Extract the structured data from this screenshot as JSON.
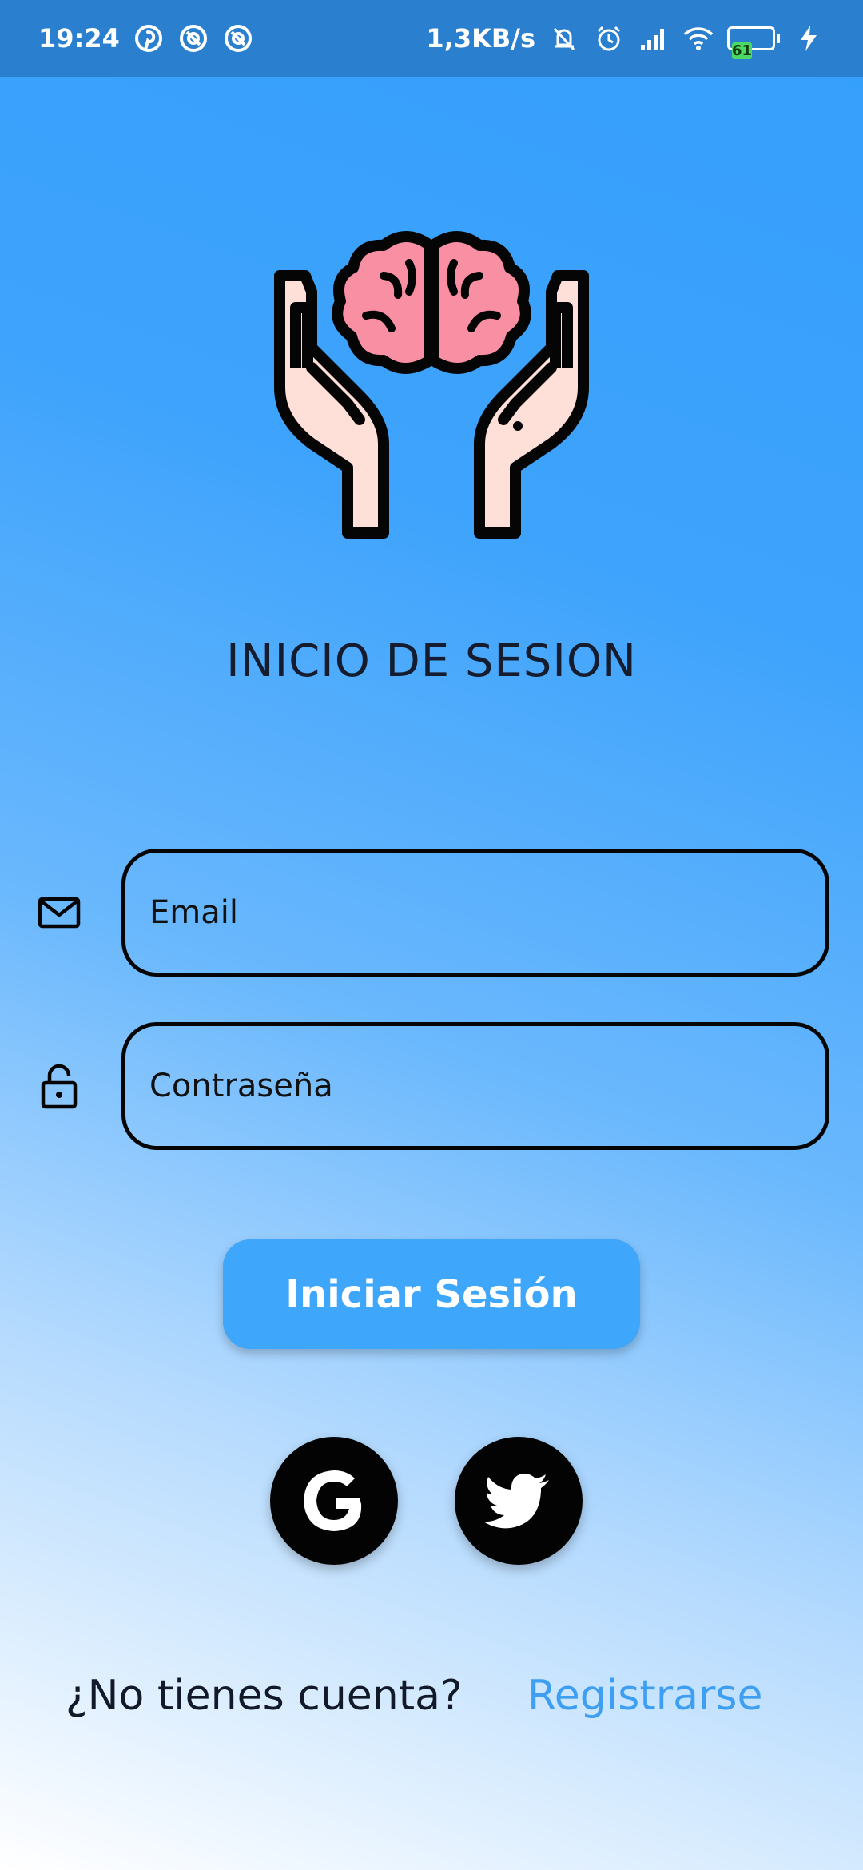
{
  "status_bar": {
    "time": "19:24",
    "net_speed": "1,3KB/s",
    "battery_level": "61",
    "icons": [
      "pinterest-icon",
      "app-notification-icon",
      "app-notification-icon",
      "mute-icon",
      "alarm-icon",
      "signal-icon",
      "wifi-icon",
      "battery-icon",
      "charging-icon"
    ]
  },
  "logo": {
    "icon": "brain-in-hands-icon"
  },
  "title": "INICIO DE SESION",
  "form": {
    "email": {
      "placeholder": "Email",
      "value": "",
      "icon": "mail-icon"
    },
    "password": {
      "placeholder": "Contraseña",
      "value": "",
      "icon": "lock-icon"
    },
    "submit_label": "Iniciar Sesión"
  },
  "social": {
    "google_icon": "google-icon",
    "twitter_icon": "twitter-icon"
  },
  "footer": {
    "question": "¿No tienes cuenta?",
    "register_label": "Registrarse"
  },
  "colors": {
    "status_bar": "#2b7fcf",
    "primary_button": "#3ea6fb",
    "link": "#3e9ff2",
    "brain": "#f98fa3",
    "hands": "#ffe0d8"
  }
}
